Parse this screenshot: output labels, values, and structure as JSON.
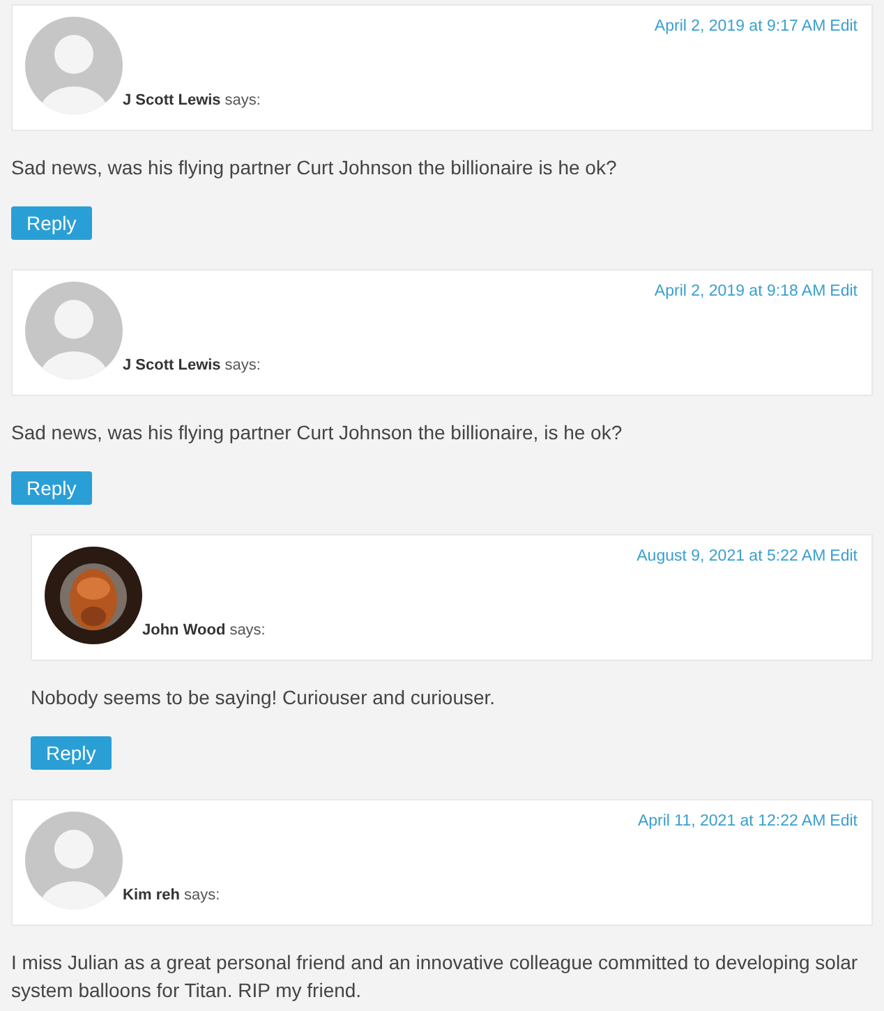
{
  "comments": [
    {
      "author": "J Scott Lewis",
      "says": "says:",
      "date": "April 2, 2019 at 9:17 AM",
      "edit": "Edit",
      "avatar": {
        "kind": "default"
      },
      "text": "Sad news, was his flying partner Curt Johnson the billionaire is he ok?",
      "reply": "Reply"
    },
    {
      "author": "J Scott Lewis",
      "says": "says:",
      "date": "April 2, 2019 at 9:18 AM",
      "edit": "Edit",
      "avatar": {
        "kind": "default"
      },
      "text": "Sad news, was his flying partner Curt Johnson the billionaire, is he ok?",
      "reply": "Reply",
      "children": [
        {
          "author": "John Wood",
          "says": "says:",
          "date": "August 9, 2021 at 5:22 AM",
          "edit": "Edit",
          "text": "Nobody seems to be saying! Curiouser and curiouser.",
          "reply": "Reply"
        }
      ]
    },
    {
      "author": "Kim reh",
      "says": "says:",
      "date": "April 11, 2021 at 12:22 AM",
      "edit": "Edit",
      "avatar": {
        "kind": "default"
      },
      "text": "I miss Julian as a great personal friend and an innovative colleague committed to developing solar system balloons for Titan. RIP my friend."
    }
  ]
}
